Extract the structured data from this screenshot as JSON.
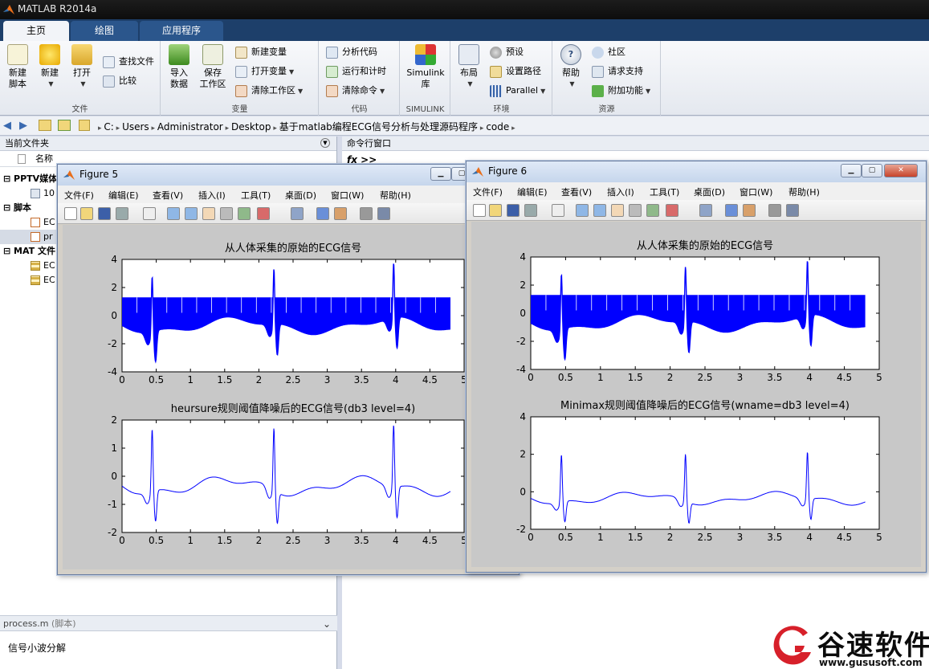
{
  "app": {
    "title": "MATLAB R2014a"
  },
  "tabs": [
    {
      "label": "主页",
      "active": true
    },
    {
      "label": "绘图",
      "active": false
    },
    {
      "label": "应用程序",
      "active": false
    }
  ],
  "ribbon": {
    "file": {
      "label": "文件",
      "new_script": [
        "新建",
        "脚本"
      ],
      "new": "新建",
      "open": "打开",
      "find_files": "查找文件",
      "compare": "比较"
    },
    "variable": {
      "label": "变量",
      "import": [
        "导入",
        "数据"
      ],
      "save": [
        "保存",
        "工作区"
      ],
      "new_var": "新建变量",
      "open_var": "打开变量",
      "clear_ws": "清除工作区"
    },
    "code": {
      "label": "代码",
      "analyze": "分析代码",
      "run_time": "运行和计时",
      "clear_cmd": "清除命令"
    },
    "simulink": {
      "label": "SIMULINK",
      "lib": [
        "Simulink",
        "库"
      ]
    },
    "env": {
      "label": "环境",
      "layout": "布局",
      "prefs": "预设",
      "set_path": "设置路径",
      "parallel": "Parallel"
    },
    "resources": {
      "label": "资源",
      "help": "帮助",
      "community": "社区",
      "support": "请求支持",
      "addons": "附加功能"
    }
  },
  "address": {
    "segments": [
      "C:",
      "Users",
      "Administrator",
      "Desktop",
      "基于matlab编程ECG信号分析与处理源码程序",
      "code"
    ]
  },
  "left_pane": {
    "header": "当前文件夹",
    "col_name": "名称",
    "rows": [
      {
        "text": "PPTV媒体",
        "bold": true
      },
      {
        "text": "10",
        "bold": false
      },
      {
        "text": "脚本",
        "bold": true
      },
      {
        "text": "EC",
        "bold": false
      },
      {
        "text": "pr",
        "bold": false
      },
      {
        "text": "MAT 文件",
        "bold": true
      },
      {
        "text": "EC",
        "bold": false
      },
      {
        "text": "EC",
        "bold": false
      }
    ],
    "detail_name": "process.m",
    "detail_type": "(脚本)",
    "detail_text": "信号小波分解"
  },
  "cmd": {
    "header": "命令行窗口",
    "prompt": "fx >>"
  },
  "figure_menus": [
    "文件(F)",
    "编辑(E)",
    "查看(V)",
    "插入(I)",
    "工具(T)",
    "桌面(D)",
    "窗口(W)",
    "帮助(H)"
  ],
  "figures": [
    {
      "title": "Figure 5",
      "plot1_title": "从人体采集的原始的ECG信号",
      "plot2_title": "heursure规则阈值降噪后的ECG信号(db3 level=4)",
      "plot1_yticks": [
        "4",
        "2",
        "0",
        "-2",
        "-4"
      ],
      "plot2_yticks": [
        "2",
        "1",
        "0",
        "-1",
        "-2"
      ],
      "xticks": [
        "0",
        "0.5",
        "1",
        "1.5",
        "2",
        "2.5",
        "3",
        "3.5",
        "4",
        "4.5",
        "5"
      ]
    },
    {
      "title": "Figure 6",
      "plot1_title": "从人体采集的原始的ECG信号",
      "plot2_title": "Minimax规则阈值降噪后的ECG信号(wname=db3 level=4)",
      "plot1_yticks": [
        "4",
        "2",
        "0",
        "-2",
        "-4"
      ],
      "plot2_yticks": [
        "4",
        "2",
        "0",
        "-2"
      ],
      "xticks": [
        "0",
        "0.5",
        "1",
        "1.5",
        "2",
        "2.5",
        "3",
        "3.5",
        "4",
        "4.5",
        "5"
      ]
    }
  ],
  "watermark": {
    "name": "谷速软件",
    "url": "www.gususoft.com"
  },
  "chart_data": [
    {
      "type": "line",
      "title": "从人体采集的原始的ECG信号",
      "xlim": [
        0,
        5
      ],
      "ylim": [
        -4,
        4
      ],
      "series": [
        {
          "x": [
            0,
            0.38,
            0.44,
            0.5,
            1.0,
            2.2,
            2.25,
            3.95,
            4.0,
            4.8
          ],
          "y": [
            -0.5,
            -2.0,
            3.2,
            -1.5,
            -1.4,
            2.6,
            -2.5,
            2.8,
            -2.7,
            -1.5
          ]
        }
      ]
    },
    {
      "type": "line",
      "title": "heursure规则阈值降噪后的ECG信号(db3 level=4)",
      "xlim": [
        0,
        5
      ],
      "ylim": [
        -2,
        2
      ],
      "series": [
        {
          "x": [
            0,
            0.3,
            0.4,
            0.44,
            0.48,
            1.0,
            2.2,
            2.24,
            3.95,
            4.0,
            4.8
          ],
          "y": [
            0.0,
            -0.4,
            -0.8,
            1.9,
            -0.3,
            -0.7,
            1.4,
            -1.0,
            1.3,
            -1.3,
            0.2
          ]
        }
      ]
    },
    {
      "type": "line",
      "title": "从人体采集的原始的ECG信号",
      "xlim": [
        0,
        5
      ],
      "ylim": [
        -4,
        4
      ],
      "series": [
        {
          "x": [
            0,
            0.38,
            0.44,
            0.5,
            1.0,
            2.2,
            2.25,
            3.95,
            4.0,
            4.8
          ],
          "y": [
            -0.5,
            -2.0,
            3.2,
            -1.5,
            -1.4,
            2.6,
            -2.5,
            2.8,
            -2.7,
            -1.5
          ]
        }
      ]
    },
    {
      "type": "line",
      "title": "Minimax规则阈值降噪后的ECG信号(wname=db3 level=4)",
      "xlim": [
        0,
        5
      ],
      "ylim": [
        -2,
        4
      ],
      "series": [
        {
          "x": [
            0,
            0.3,
            0.4,
            0.44,
            0.48,
            1.0,
            2.2,
            2.24,
            3.95,
            4.0,
            4.8
          ],
          "y": [
            0.0,
            -0.5,
            -0.9,
            2.1,
            -0.4,
            -0.7,
            1.2,
            -1.0,
            1.2,
            -1.3,
            0.3
          ]
        }
      ]
    }
  ]
}
